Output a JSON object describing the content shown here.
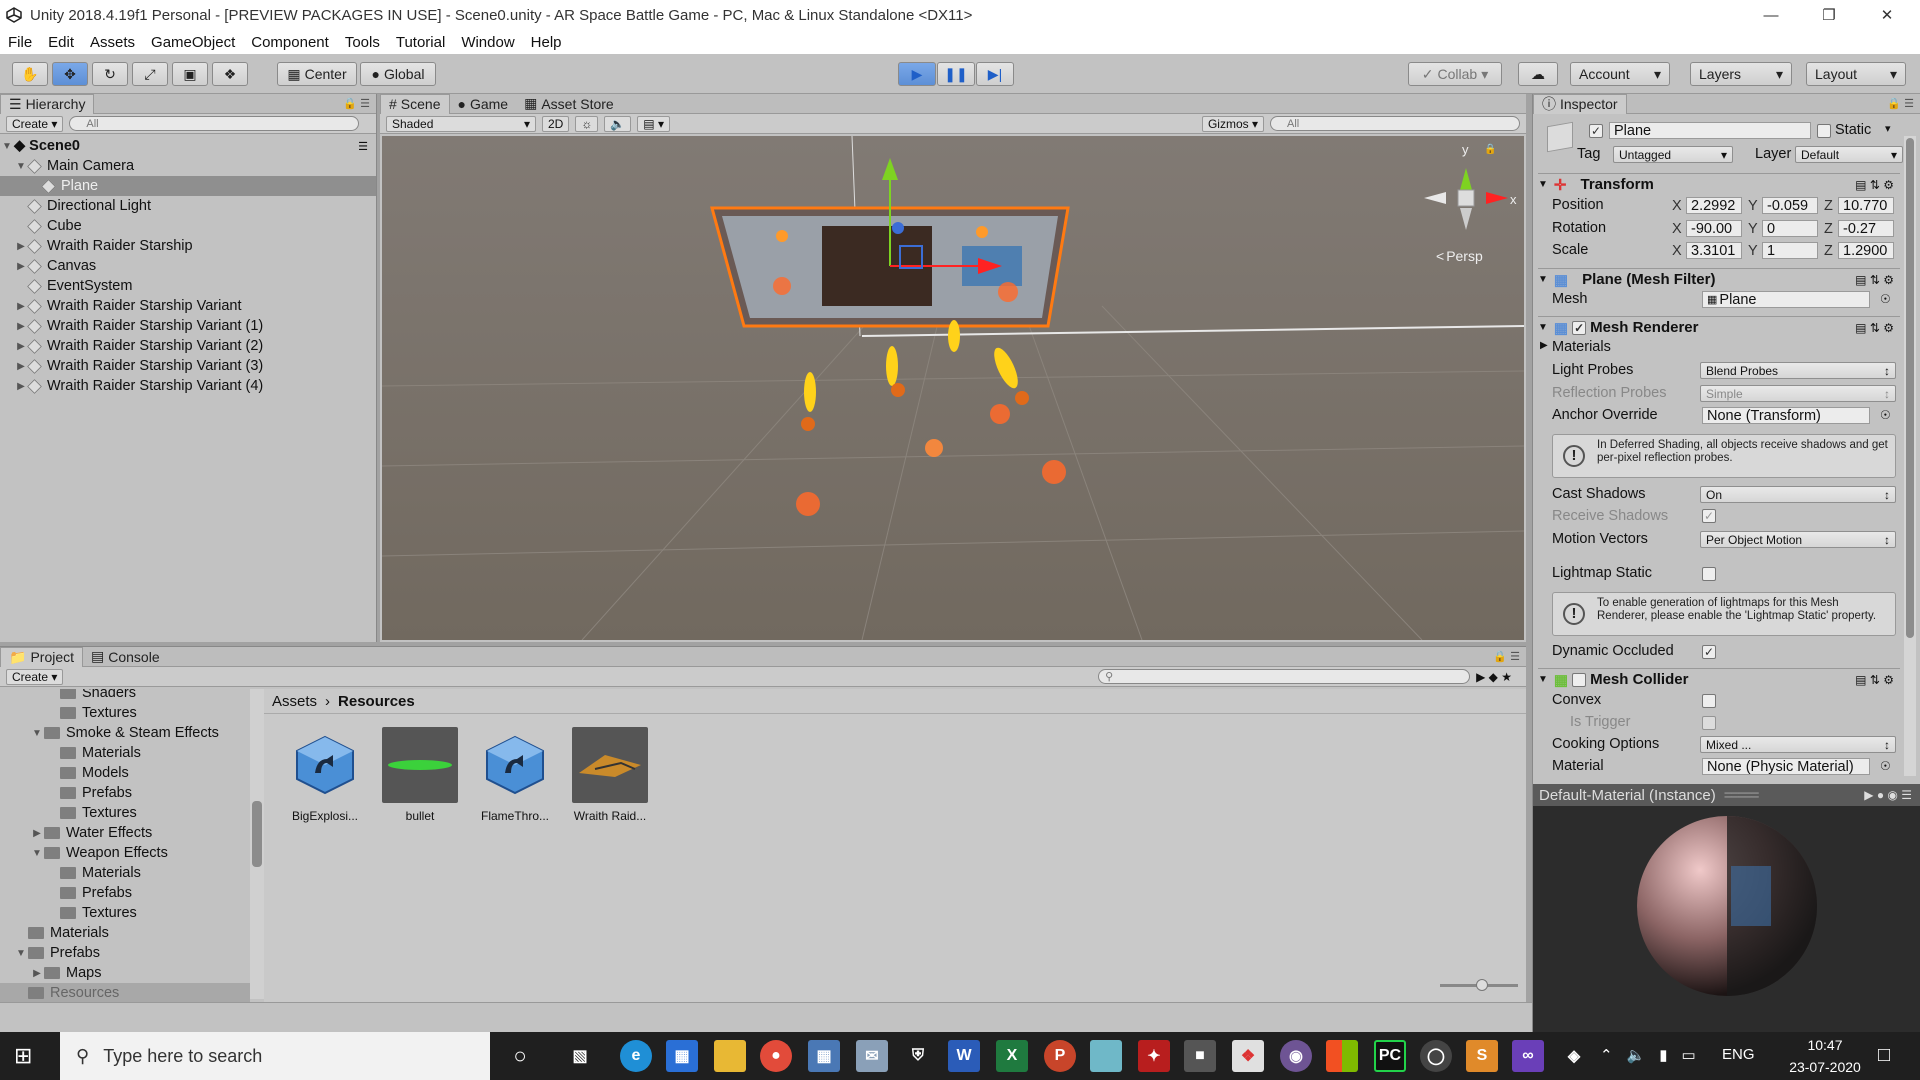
{
  "window": {
    "title": "Unity 2018.4.19f1 Personal - [PREVIEW PACKAGES IN USE] - Scene0.unity - AR Space Battle Game - PC, Mac & Linux Standalone <DX11>"
  },
  "menu": [
    "File",
    "Edit",
    "Assets",
    "GameObject",
    "Component",
    "Tools",
    "Tutorial",
    "Window",
    "Help"
  ],
  "toolbar": {
    "center": "Center",
    "global": "Global",
    "collab": "Collab",
    "account": "Account",
    "layers": "Layers",
    "layout": "Layout"
  },
  "hierarchy": {
    "tab": "Hierarchy",
    "create": "Create",
    "search": "All",
    "scene": "Scene0",
    "items": [
      {
        "label": "Main Camera",
        "depth": 1,
        "expanded": true
      },
      {
        "label": "Plane",
        "depth": 2,
        "selected": true
      },
      {
        "label": "Directional Light",
        "depth": 1
      },
      {
        "label": "Cube",
        "depth": 1
      },
      {
        "label": "Wraith Raider Starship",
        "depth": 1,
        "collapsed": true
      },
      {
        "label": "Canvas",
        "depth": 1,
        "collapsed": true
      },
      {
        "label": "EventSystem",
        "depth": 1
      },
      {
        "label": "Wraith Raider Starship Variant",
        "depth": 1,
        "collapsed": true
      },
      {
        "label": "Wraith Raider Starship Variant (1)",
        "depth": 1,
        "collapsed": true
      },
      {
        "label": "Wraith Raider Starship Variant (2)",
        "depth": 1,
        "collapsed": true
      },
      {
        "label": "Wraith Raider Starship Variant (3)",
        "depth": 1,
        "collapsed": true
      },
      {
        "label": "Wraith Raider Starship Variant (4)",
        "depth": 1,
        "collapsed": true
      }
    ]
  },
  "scene": {
    "tabs": [
      "Scene",
      "Game",
      "Asset Store"
    ],
    "shading": "Shaded",
    "mode2d": "2D",
    "gizmos": "Gizmos",
    "search": "All",
    "persp": "Persp",
    "gizmo_y": "y",
    "gizmo_x": "x"
  },
  "project": {
    "tabs": [
      "Project",
      "Console"
    ],
    "create": "Create",
    "tree": [
      {
        "label": "Shaders",
        "depth": 2
      },
      {
        "label": "Textures",
        "depth": 2
      },
      {
        "label": "Smoke & Steam Effects",
        "depth": 1,
        "expanded": true
      },
      {
        "label": "Materials",
        "depth": 2
      },
      {
        "label": "Models",
        "depth": 2
      },
      {
        "label": "Prefabs",
        "depth": 2
      },
      {
        "label": "Textures",
        "depth": 2
      },
      {
        "label": "Water Effects",
        "depth": 1,
        "collapsed": true
      },
      {
        "label": "Weapon Effects",
        "depth": 1,
        "expanded": true
      },
      {
        "label": "Materials",
        "depth": 2
      },
      {
        "label": "Prefabs",
        "depth": 2
      },
      {
        "label": "Textures",
        "depth": 2
      },
      {
        "label": "Materials",
        "depth": 0
      },
      {
        "label": "Prefabs",
        "depth": 0,
        "expanded": true
      },
      {
        "label": "Maps",
        "depth": 1,
        "collapsed": true
      },
      {
        "label": "Resources",
        "depth": 0,
        "selected": true
      }
    ],
    "breadcrumb": [
      "Assets",
      "Resources"
    ],
    "assets": [
      {
        "label": "BigExplosi...",
        "kind": "prefab"
      },
      {
        "label": "bullet",
        "kind": "bullet"
      },
      {
        "label": "FlameThro...",
        "kind": "prefab"
      },
      {
        "label": "Wraith Raid...",
        "kind": "ship"
      }
    ]
  },
  "inspector": {
    "tab": "Inspector",
    "name": "Plane",
    "static": "Static",
    "tag_label": "Tag",
    "tag": "Untagged",
    "layer_label": "Layer",
    "layer": "Default",
    "transform": {
      "title": "Transform",
      "position_label": "Position",
      "rotation_label": "Rotation",
      "scale_label": "Scale",
      "position": {
        "x": "2.2992",
        "y": "-0.059",
        "z": "10.770"
      },
      "rotation": {
        "x": "-90.00",
        "y": "0",
        "z": "-0.27"
      },
      "scale": {
        "x": "3.3101",
        "y": "1",
        "z": "1.2900"
      }
    },
    "mesh_filter": {
      "title": "Plane (Mesh Filter)",
      "mesh_label": "Mesh",
      "mesh": "Plane"
    },
    "mesh_renderer": {
      "title": "Mesh Renderer",
      "materials": "Materials",
      "light_probes_label": "Light Probes",
      "light_probes": "Blend Probes",
      "reflection_label": "Reflection Probes",
      "reflection": "Simple",
      "anchor_label": "Anchor Override",
      "anchor": "None (Transform)",
      "deferred_help": "In Deferred Shading, all objects receive shadows and get per-pixel reflection probes.",
      "cast_label": "Cast Shadows",
      "cast": "On",
      "receive_label": "Receive Shadows",
      "motion_label": "Motion Vectors",
      "motion": "Per Object Motion",
      "lightmap_label": "Lightmap Static",
      "lightmap_help": "To enable generation of lightmaps for this Mesh Renderer, please enable the 'Lightmap Static' property.",
      "occluded_label": "Dynamic Occluded"
    },
    "mesh_collider": {
      "title": "Mesh Collider",
      "convex_label": "Convex",
      "trigger_label": "Is Trigger",
      "cooking_label": "Cooking Options",
      "cooking": "Mixed ...",
      "material_label": "Material",
      "material": "None (Physic Material)"
    },
    "preview_title": "Default-Material (Instance)"
  },
  "taskbar": {
    "search_placeholder": "Type here to search",
    "lang": "ENG",
    "time": "10:47",
    "date": "23-07-2020",
    "icons": [
      "cortana-icon",
      "task-view-icon",
      "edge-icon",
      "store-icon",
      "explorer-icon",
      "chrome-icon",
      "calculator-icon",
      "mail-icon",
      "security-icon",
      "word-icon",
      "excel-icon",
      "powerpoint-icon",
      "notepad-icon",
      "acrobat-icon",
      "terminal-icon",
      "unity-hub-icon",
      "github-icon",
      "office-icon",
      "pycharm-icon",
      "steering-icon",
      "sublime-icon",
      "visual-studio-icon",
      "unity-icon"
    ],
    "word": "W",
    "excel": "X",
    "powerpoint": "P",
    "pycharm": "PC"
  }
}
